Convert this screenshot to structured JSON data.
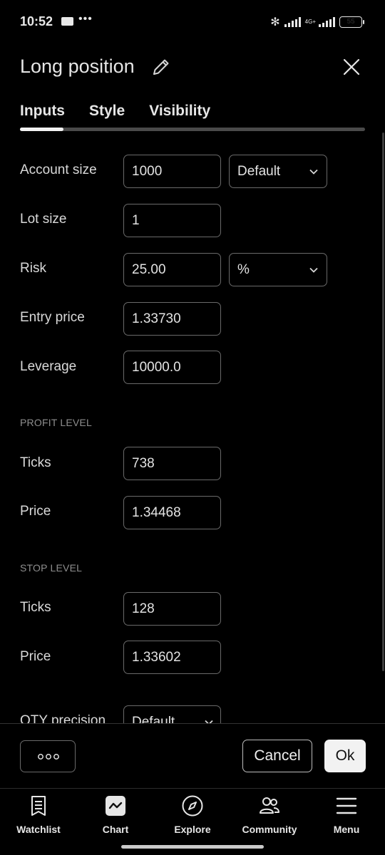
{
  "status_bar": {
    "time": "10:52",
    "network": "4G+",
    "battery_level": "55",
    "battery_color": "#f5b83d"
  },
  "header": {
    "title": "Long position"
  },
  "tabs": [
    {
      "label": "Inputs",
      "active": true
    },
    {
      "label": "Style",
      "active": false
    },
    {
      "label": "Visibility",
      "active": false
    }
  ],
  "form": {
    "account_size": {
      "label": "Account size",
      "value": "1000",
      "select": "Default"
    },
    "lot_size": {
      "label": "Lot size",
      "value": "1"
    },
    "risk": {
      "label": "Risk",
      "value": "25.00",
      "select": "%"
    },
    "entry_price": {
      "label": "Entry price",
      "value": "1.33730"
    },
    "leverage": {
      "label": "Leverage",
      "value": "10000.0"
    },
    "profit_level": {
      "header": "PROFIT LEVEL",
      "ticks_label": "Ticks",
      "ticks_value": "738",
      "price_label": "Price",
      "price_value": "1.34468"
    },
    "stop_level": {
      "header": "STOP LEVEL",
      "ticks_label": "Ticks",
      "ticks_value": "128",
      "price_label": "Price",
      "price_value": "1.33602"
    },
    "qty_precision": {
      "label": "QTY precision",
      "select": "Default"
    }
  },
  "footer": {
    "more_label": "○○○",
    "cancel_label": "Cancel",
    "ok_label": "Ok"
  },
  "bottom_nav": [
    {
      "label": "Watchlist",
      "icon": "watchlist-icon"
    },
    {
      "label": "Chart",
      "icon": "chart-icon"
    },
    {
      "label": "Explore",
      "icon": "compass-icon"
    },
    {
      "label": "Community",
      "icon": "community-icon"
    },
    {
      "label": "Menu",
      "icon": "menu-icon"
    }
  ],
  "colors": {
    "background": "#000000",
    "text": "#dbdbdb",
    "border": "#6a6a6a",
    "section_header": "#8e8e8e",
    "ok_button": "#f2f2f2"
  }
}
